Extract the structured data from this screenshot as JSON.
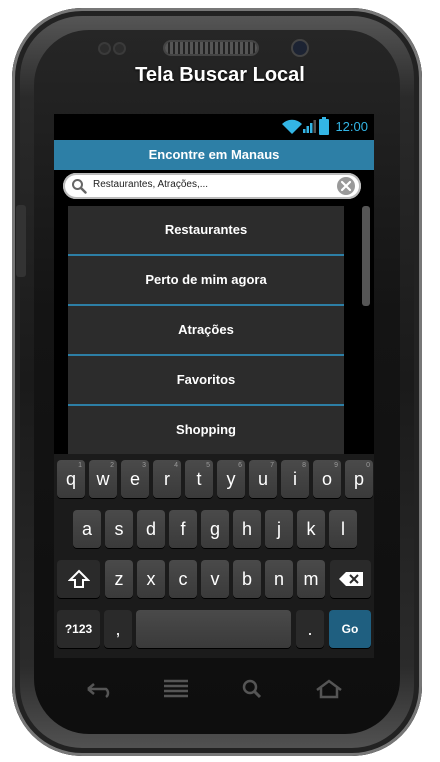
{
  "page": {
    "title": "Tela Buscar Local"
  },
  "status": {
    "time": "12:00"
  },
  "app": {
    "header": "Encontre em Manaus"
  },
  "search": {
    "value": "Restaurantes, Atrações,..."
  },
  "menu": {
    "items": [
      {
        "label": "Restaurantes"
      },
      {
        "label": "Perto de mim agora"
      },
      {
        "label": "Atrações"
      },
      {
        "label": "Favoritos"
      },
      {
        "label": "Shopping"
      }
    ]
  },
  "keyboard": {
    "row1": [
      "q",
      "w",
      "e",
      "r",
      "t",
      "y",
      "u",
      "i",
      "o",
      "p"
    ],
    "row1_hints": [
      "1",
      "2",
      "3",
      "4",
      "5",
      "6",
      "7",
      "8",
      "9",
      "0"
    ],
    "row2": [
      "a",
      "s",
      "d",
      "f",
      "g",
      "h",
      "j",
      "k",
      "l"
    ],
    "row3": [
      "z",
      "x",
      "c",
      "v",
      "b",
      "n",
      "m"
    ],
    "symbols_key": "?123",
    "comma_key": ",",
    "period_key": ".",
    "go_key": "Go"
  }
}
